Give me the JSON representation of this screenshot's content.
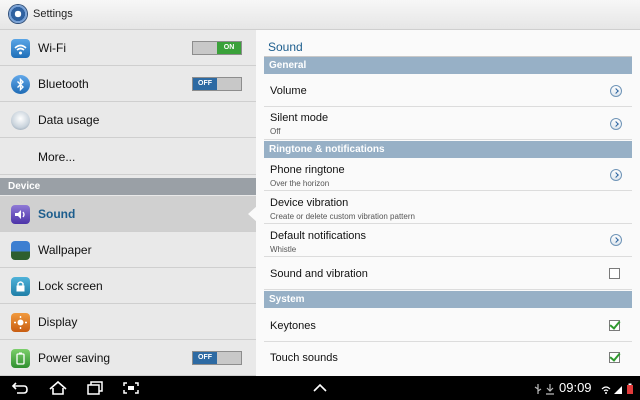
{
  "app_title": "Settings",
  "left": {
    "items": [
      {
        "label": "Wi-Fi",
        "icon": "wifi-icon"
      },
      {
        "label": "Bluetooth",
        "icon": "bluetooth-icon"
      },
      {
        "label": "Data usage",
        "icon": "data-usage-icon"
      },
      {
        "label": "More..."
      }
    ],
    "section_device": "Device",
    "device_items": [
      {
        "label": "Sound",
        "icon": "sound-icon",
        "selected": true
      },
      {
        "label": "Wallpaper",
        "icon": "wallpaper-icon"
      },
      {
        "label": "Lock screen",
        "icon": "lock-icon"
      },
      {
        "label": "Display",
        "icon": "display-icon"
      },
      {
        "label": "Power saving",
        "icon": "power-saving-icon"
      }
    ],
    "toggles": {
      "wifi": "ON",
      "bluetooth": "OFF",
      "power_saving": "OFF"
    }
  },
  "right": {
    "title": "Sound",
    "sections": {
      "general": "General",
      "ringtone": "Ringtone & notifications",
      "system": "System"
    },
    "rows": {
      "volume": {
        "title": "Volume"
      },
      "silent": {
        "title": "Silent mode",
        "subtitle": "Off"
      },
      "phone_ringtone": {
        "title": "Phone ringtone",
        "subtitle": "Over the horizon"
      },
      "device_vibration": {
        "title": "Device vibration",
        "subtitle": "Create or delete custom vibration pattern"
      },
      "default_notifications": {
        "title": "Default notifications",
        "subtitle": "Whistle"
      },
      "sound_and_vibration": {
        "title": "Sound and vibration",
        "checked": false
      },
      "keytones": {
        "title": "Keytones",
        "checked": true
      },
      "touch_sounds": {
        "title": "Touch sounds",
        "checked": true
      }
    }
  },
  "status": {
    "time": "09:09"
  },
  "colors": {
    "accent": "#1c5d8d",
    "section": "#97b0c6",
    "toggle_on": "#3aa13a",
    "toggle_off": "#2d6aa3"
  }
}
